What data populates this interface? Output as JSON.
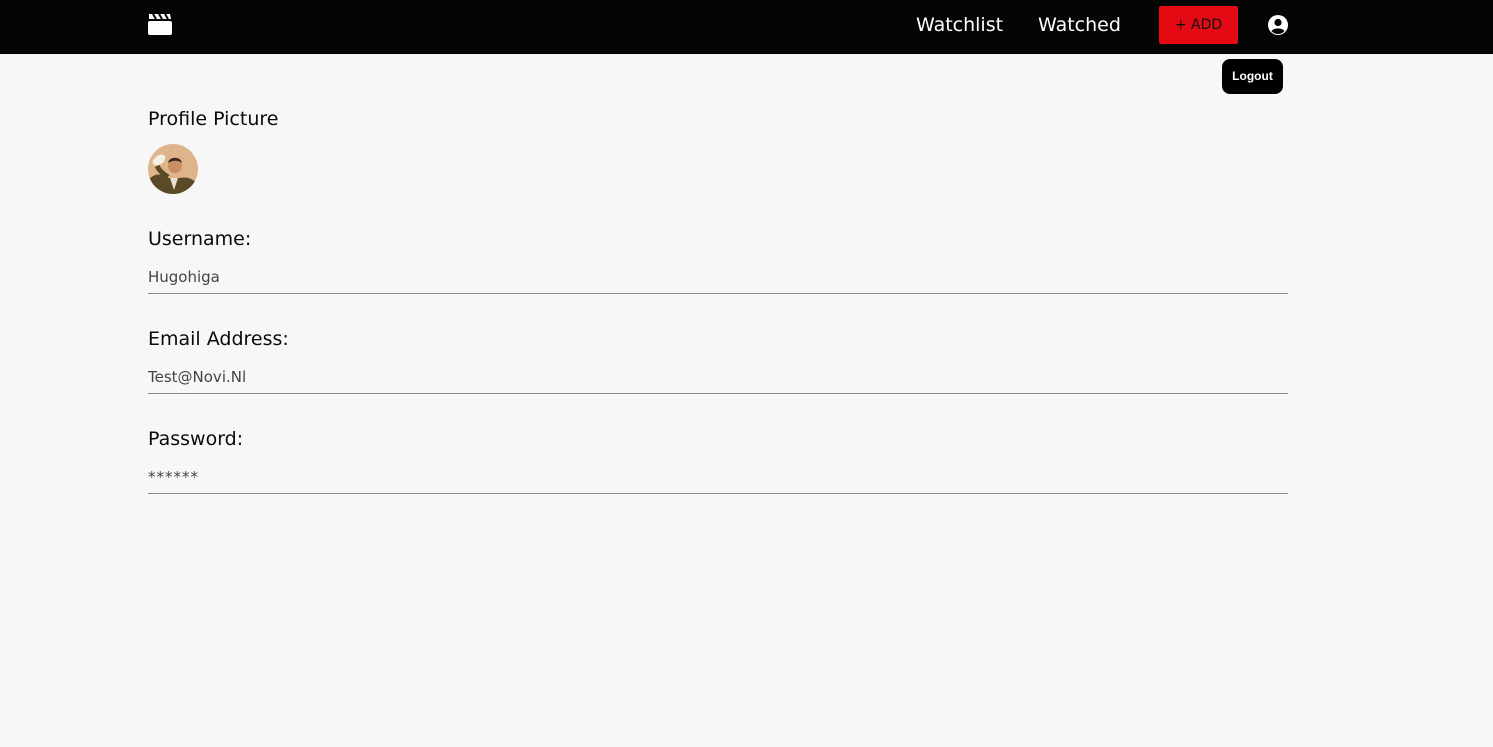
{
  "nav": {
    "logo_icon": "clapperboard-icon",
    "links": [
      "Watchlist",
      "Watched"
    ],
    "add_label": "+ ADD",
    "user_icon": "user-circle-icon",
    "accent_color": "#e50914",
    "background": "#050505"
  },
  "user_menu": {
    "logout_label": "Logout"
  },
  "profile": {
    "picture_title": "Profile Picture",
    "username_label": "Username:",
    "username_value": "Hugohiga",
    "email_label": "Email Address:",
    "email_value": "Test@Novi.Nl",
    "password_label": "Password:",
    "password_value": "******"
  }
}
